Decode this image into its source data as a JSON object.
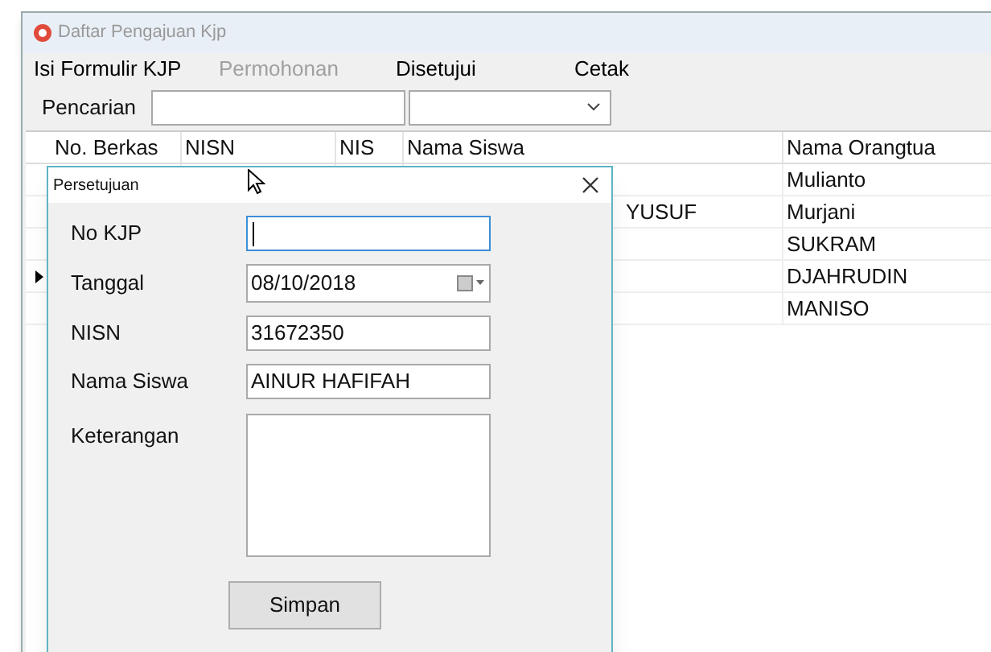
{
  "window": {
    "title": "Daftar Pengajuan Kjp"
  },
  "menu": [
    {
      "label": "Isi Formulir KJP",
      "disabled": false
    },
    {
      "label": "Permohonan",
      "disabled": true
    },
    {
      "label": "Disetujui",
      "disabled": false
    },
    {
      "label": "Cetak",
      "disabled": false
    }
  ],
  "search": {
    "label": "Pencarian"
  },
  "table": {
    "columns": [
      "No. Berkas",
      "NISN",
      "NIS",
      "Nama Siswa",
      "Nama Orangtua"
    ],
    "rows": [
      {
        "current": false,
        "cells": [
          null,
          null,
          null,
          null,
          "Mulianto"
        ]
      },
      {
        "current": false,
        "cells": [
          null,
          null,
          null,
          "YUSUF",
          "Murjani"
        ]
      },
      {
        "current": false,
        "cells": [
          null,
          null,
          null,
          null,
          "SUKRAM"
        ]
      },
      {
        "current": true,
        "cells": [
          null,
          null,
          null,
          null,
          "DJAHRUDIN"
        ]
      },
      {
        "current": false,
        "cells": [
          null,
          null,
          null,
          null,
          "MANISO"
        ]
      }
    ]
  },
  "dialog": {
    "title": "Persetujuan",
    "fields": [
      {
        "label": "No KJP",
        "kind": "text",
        "focused": true
      },
      {
        "label": "Tanggal",
        "kind": "date",
        "value": "08/10/2018",
        "focused": false
      },
      {
        "label": "NISN",
        "kind": "text",
        "value": "31672350",
        "focused": false
      },
      {
        "label": "Nama Siswa",
        "kind": "text",
        "value": "AINUR HAFIFAH",
        "focused": false
      },
      {
        "label": "Keterangan",
        "kind": "textarea",
        "focused": false
      }
    ],
    "button": "Simpan"
  }
}
